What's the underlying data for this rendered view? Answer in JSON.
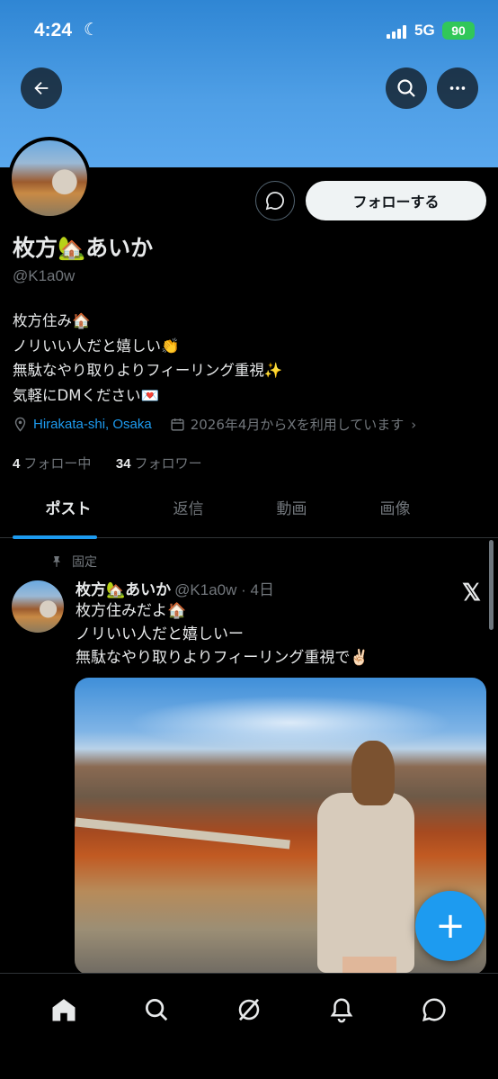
{
  "status_bar": {
    "time": "4:24",
    "network": "5G",
    "battery": "90"
  },
  "profile": {
    "display_name": "枚方🏡あいか",
    "handle": "@K1a0w",
    "follow_label": "フォローする",
    "bio_lines": [
      "枚方住み🏠",
      "ノリいい人だと嬉しい👏",
      "無駄なやり取りよりフィーリング重視✨",
      "気軽にDMください💌"
    ],
    "location": "Hirakata-shi, Osaka",
    "joined": "2026年4月からXを利用しています",
    "following_count": "4",
    "following_label": "フォロー中",
    "followers_count": "34",
    "followers_label": "フォロワー"
  },
  "tabs": [
    "ポスト",
    "返信",
    "動画",
    "画像"
  ],
  "pinned_post": {
    "pinned_label": "固定",
    "author_name": "枚方🏡あいか",
    "author_handle": "@K1a0w · 4日",
    "lines": [
      "枚方住みだよ🏠",
      "ノリいい人だと嬉しいー",
      "無駄なやり取りよりフィーリング重視で✌🏻"
    ]
  },
  "icons": {
    "back": "arrow-left-icon",
    "search": "search-icon",
    "more": "more-horizontal-icon",
    "message": "message-bubble-icon",
    "location": "location-pin-icon",
    "calendar": "calendar-icon",
    "pin": "pin-icon",
    "x_logo": "x-logo-icon",
    "compose": "plus-icon",
    "nav": [
      "home-icon",
      "search-icon",
      "grok-icon",
      "bell-icon",
      "messages-icon"
    ]
  },
  "colors": {
    "accent": "#1d9bf0",
    "banner": "#4f9fe6",
    "background": "#000000"
  }
}
